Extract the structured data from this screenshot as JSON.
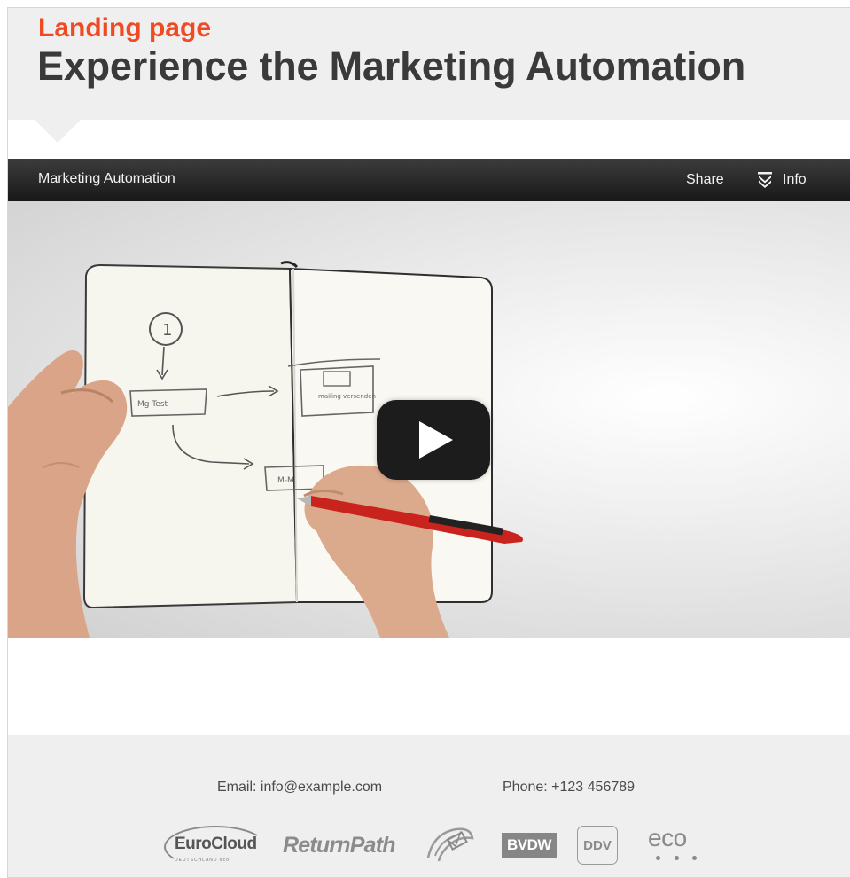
{
  "header": {
    "kicker": "Landing page",
    "title": "Experience the Marketing Automation"
  },
  "video": {
    "title": "Marketing Automation",
    "share_label": "Share",
    "info_label": "Info",
    "sketch_labels": [
      "1",
      "Mg Test",
      "mailing versenden",
      "M-M"
    ]
  },
  "footer": {
    "email": "Email: info@example.com",
    "phone": "Phone: +123 456789",
    "logos": {
      "eurocloud": "EuroCloud",
      "eurocloud_sub": "DEUTSCHLAND eco",
      "returnpath": "ReturnPath",
      "bvdw": "BVDW",
      "ddv": "DDV",
      "eco": "eco"
    }
  },
  "colors": {
    "accent": "#ef4a23",
    "title": "#3a3a3a",
    "player_bar": "#222222",
    "play_button": "#1c1c1c"
  }
}
